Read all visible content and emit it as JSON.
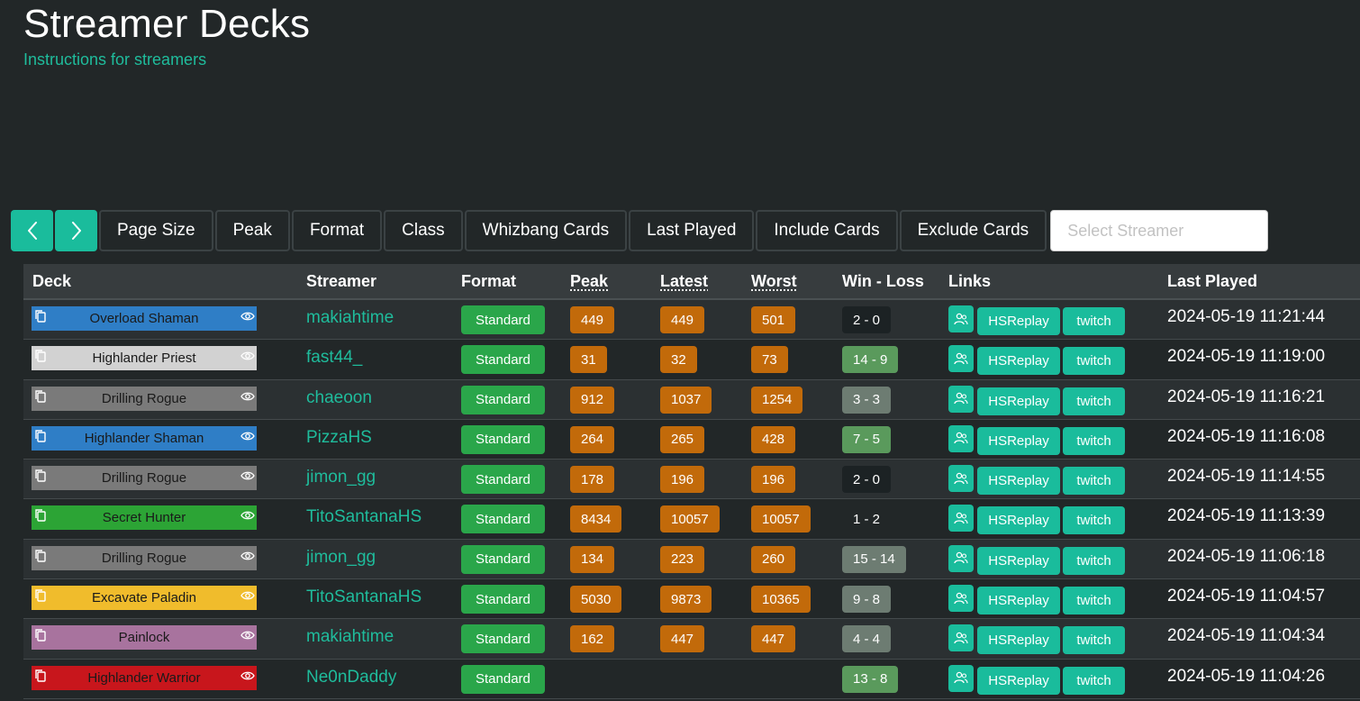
{
  "header": {
    "title": "Streamer Decks",
    "instructions_link": "Instructions for streamers"
  },
  "toolbar": {
    "buttons": [
      "Page Size",
      "Peak",
      "Format",
      "Class",
      "Whizbang Cards",
      "Last Played",
      "Include Cards",
      "Exclude Cards"
    ],
    "streamer_placeholder": "Select Streamer"
  },
  "table": {
    "headers": {
      "deck": "Deck",
      "streamer": "Streamer",
      "format": "Format",
      "peak": "Peak",
      "latest": "Latest",
      "worst": "Worst",
      "winloss": "Win - Loss",
      "links": "Links",
      "last_played": "Last Played"
    },
    "rows": [
      {
        "deck": "Overload Shaman",
        "deck_color": "#2f7ec6",
        "deck_text": "#1a1a1a",
        "streamer": "makiahtime",
        "format": "Standard",
        "peak": "449",
        "latest": "449",
        "worst": "501",
        "winloss": "2 - 0",
        "wl_color": "#1c2224",
        "hsreplay": "HSReplay",
        "twitch": "twitch",
        "last_played": "2024-05-19 11:21:44"
      },
      {
        "deck": "Highlander Priest",
        "deck_color": "#d2d2d2",
        "deck_text": "#1a1a1a",
        "streamer": "fast44_",
        "format": "Standard",
        "peak": "31",
        "latest": "32",
        "worst": "73",
        "winloss": "14 - 9",
        "wl_color": "#5a9a5c",
        "hsreplay": "HSReplay",
        "twitch": "twitch",
        "last_played": "2024-05-19 11:19:00"
      },
      {
        "deck": "Drilling Rogue",
        "deck_color": "#7a7a7a",
        "deck_text": "#1a1a1a",
        "streamer": "chaeoon",
        "format": "Standard",
        "peak": "912",
        "latest": "1037",
        "worst": "1254",
        "winloss": "3 - 3",
        "wl_color": "#6d7c72",
        "hsreplay": "HSReplay",
        "twitch": "twitch",
        "last_played": "2024-05-19 11:16:21"
      },
      {
        "deck": "Highlander Shaman",
        "deck_color": "#2f7ec6",
        "deck_text": "#1a1a1a",
        "streamer": "PizzaHS",
        "format": "Standard",
        "peak": "264",
        "latest": "265",
        "worst": "428",
        "winloss": "7 - 5",
        "wl_color": "#5a9a5c",
        "hsreplay": "HSReplay",
        "twitch": "twitch",
        "last_played": "2024-05-19 11:16:08"
      },
      {
        "deck": "Drilling Rogue",
        "deck_color": "#7a7a7a",
        "deck_text": "#1a1a1a",
        "streamer": "jimon_gg",
        "format": "Standard",
        "peak": "178",
        "latest": "196",
        "worst": "196",
        "winloss": "2 - 0",
        "wl_color": "#1c2224",
        "hsreplay": "HSReplay",
        "twitch": "twitch",
        "last_played": "2024-05-19 11:14:55"
      },
      {
        "deck": "Secret Hunter",
        "deck_color": "#2ca435",
        "deck_text": "#1a1a1a",
        "streamer": "TitoSantanaHS",
        "format": "Standard",
        "peak": "8434",
        "latest": "10057",
        "worst": "10057",
        "winloss": "1 - 2",
        "wl_color": "transparent",
        "hsreplay": "HSReplay",
        "twitch": "twitch",
        "last_played": "2024-05-19 11:13:39"
      },
      {
        "deck": "Drilling Rogue",
        "deck_color": "#7a7a7a",
        "deck_text": "#1a1a1a",
        "streamer": "jimon_gg",
        "format": "Standard",
        "peak": "134",
        "latest": "223",
        "worst": "260",
        "winloss": "15 - 14",
        "wl_color": "#6d7c72",
        "hsreplay": "HSReplay",
        "twitch": "twitch",
        "last_played": "2024-05-19 11:06:18"
      },
      {
        "deck": "Excavate Paladin",
        "deck_color": "#f0bc2c",
        "deck_text": "#1a1a1a",
        "streamer": "TitoSantanaHS",
        "format": "Standard",
        "peak": "5030",
        "latest": "9873",
        "worst": "10365",
        "winloss": "9 - 8",
        "wl_color": "#6d7c72",
        "hsreplay": "HSReplay",
        "twitch": "twitch",
        "last_played": "2024-05-19 11:04:57"
      },
      {
        "deck": "Painlock",
        "deck_color": "#a8739e",
        "deck_text": "#1a1a1a",
        "streamer": "makiahtime",
        "format": "Standard",
        "peak": "162",
        "latest": "447",
        "worst": "447",
        "winloss": "4 - 4",
        "wl_color": "#6d7c72",
        "hsreplay": "HSReplay",
        "twitch": "twitch",
        "last_played": "2024-05-19 11:04:34"
      },
      {
        "deck": "Highlander Warrior",
        "deck_color": "#c8161c",
        "deck_text": "#1a1a1a",
        "streamer": "Ne0nDaddy",
        "format": "Standard",
        "peak": "",
        "latest": "",
        "worst": "",
        "winloss": "13 - 8",
        "wl_color": "#5a9a5c",
        "hsreplay": "HSReplay",
        "twitch": "twitch",
        "last_played": "2024-05-19 11:04:26"
      }
    ]
  },
  "icons": {
    "prev": "chevron-left-icon",
    "next": "chevron-right-icon",
    "copy": "copy-icon",
    "eye": "eye-icon",
    "users": "users-icon"
  }
}
